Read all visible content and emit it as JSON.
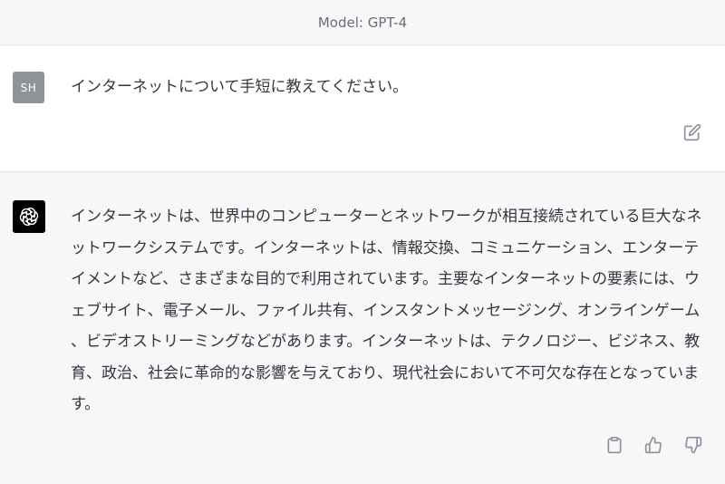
{
  "header": {
    "model_label": "Model: GPT-4"
  },
  "user_message": {
    "avatar_initials": "SH",
    "text": "インターネットについて手短に教えてください。",
    "edit_icon": "edit-icon"
  },
  "assistant_message": {
    "avatar_icon": "openai-logo-icon",
    "text": "インターネットは、世界中のコンピューターとネットワークが相互接続されている巨大なネットワークシステムです。インターネットは、情報交換、コミュニケーション、エンターテイメントなど、さまざまな目的で利用されています。主要なインターネットの要素には、ウェブサイト、電子メール、ファイル共有、インスタントメッセージング、オンラインゲーム、ビデオストリーミングなどがあります。インターネットは、テクノロジー、ビジネス、教育、政治、社会に革命的な影響を与えており、現代社会において不可欠な存在となっています。",
    "actions": {
      "copy_icon": "clipboard-icon",
      "like_icon": "thumbs-up-icon",
      "dislike_icon": "thumbs-down-icon"
    }
  },
  "colors": {
    "header_bg": "#f7f7f8",
    "assistant_bg": "#f7f7f8",
    "user_avatar_bg": "#8e9498",
    "assistant_avatar_bg": "#000000",
    "text": "#343541",
    "icon": "#8e8ea0"
  }
}
